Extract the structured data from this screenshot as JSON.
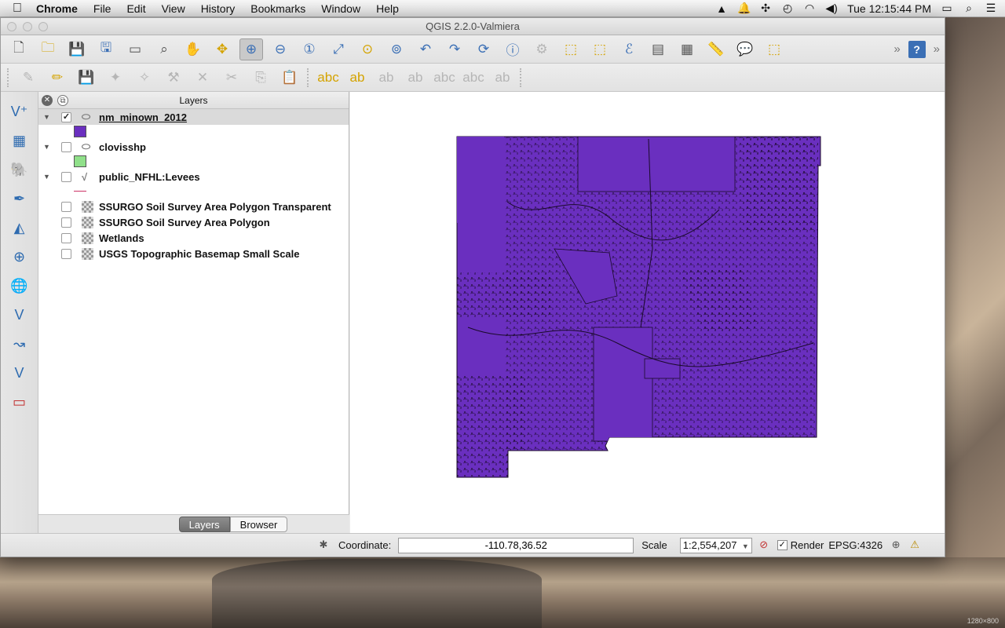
{
  "menubar": {
    "app_name": "Chrome",
    "items": [
      "File",
      "Edit",
      "View",
      "History",
      "Bookmarks",
      "Window",
      "Help"
    ],
    "clock": "Tue 12:15:44 PM"
  },
  "window": {
    "title": "QGIS 2.2.0-Valmiera"
  },
  "layers_panel": {
    "title": "Layers",
    "layers": [
      {
        "name": "nm_minown_2012",
        "checked": true,
        "expanded": true,
        "symbol_color": "#6a2fbf"
      },
      {
        "name": "clovisshp",
        "checked": false,
        "expanded": true,
        "symbol_color": "#90e08a"
      },
      {
        "name": "public_NFHL:Levees",
        "checked": false,
        "expanded": true,
        "symbol_color": "#cc3366"
      },
      {
        "name": "SSURGO Soil Survey Area Polygon Transparent",
        "checked": false
      },
      {
        "name": "SSURGO Soil Survey Area Polygon",
        "checked": false
      },
      {
        "name": "Wetlands",
        "checked": false
      },
      {
        "name": "USGS Topographic Basemap Small Scale",
        "checked": false
      }
    ],
    "tabs": {
      "layers": "Layers",
      "browser": "Browser"
    }
  },
  "map": {
    "fill_color": "#6a2fbf",
    "stroke_color": "#1a0a2a"
  },
  "statusbar": {
    "coordinate_label": "Coordinate:",
    "coordinate_value": "-110.78,36.52",
    "scale_label": "Scale",
    "scale_value": "1:2,554,207",
    "render_label": "Render",
    "render_checked": true,
    "crs": "EPSG:4326"
  },
  "desktop": {
    "watermark": "1280×800"
  }
}
